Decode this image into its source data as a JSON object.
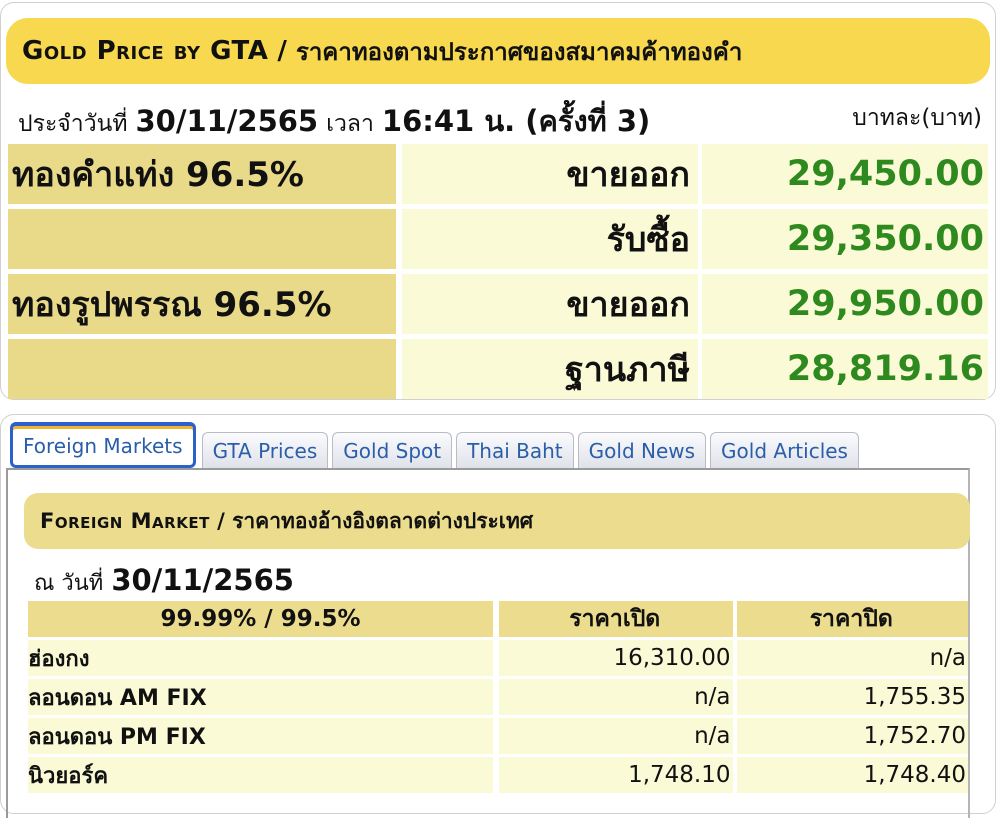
{
  "gta_panel": {
    "title_en": "Gold Price by GTA",
    "title_sep": " / ",
    "title_th": "ราคาทองตามประกาศของสมาคมค้าทองคำ",
    "date_label": "ประจำวันที่",
    "date": "30/11/2565",
    "time_label": "เวลา",
    "time": "16:41 น. (ครั้งที่ 3)",
    "unit": "บาทละ(บาท)",
    "rows": [
      {
        "name": "ทองคำแท่ง 96.5%",
        "type": "ขายออก",
        "value": "29,450.00"
      },
      {
        "name": "",
        "type": "รับซื้อ",
        "value": "29,350.00"
      },
      {
        "name": "ทองรูปพรรณ 96.5%",
        "type": "ขายออก",
        "value": "29,950.00"
      },
      {
        "name": "",
        "type": "ฐานภาษี",
        "value": "28,819.16"
      }
    ],
    "value_color": "#2e8a1e"
  },
  "tabs": [
    {
      "label": "Foreign Markets",
      "active": true
    },
    {
      "label": "GTA Prices",
      "active": false
    },
    {
      "label": "Gold Spot",
      "active": false
    },
    {
      "label": "Thai Baht",
      "active": false
    },
    {
      "label": "Gold News",
      "active": false
    },
    {
      "label": "Gold Articles",
      "active": false
    }
  ],
  "foreign_market": {
    "title_en": "Foreign Market",
    "title_sep": " / ",
    "title_th": "ราคาทองอ้างอิงตลาดต่างประเทศ",
    "date_label": "ณ วันที่",
    "date": "30/11/2565",
    "columns": [
      "99.99% / 99.5%",
      "ราคาเปิด",
      "ราคาปิด"
    ],
    "rows": [
      {
        "market": "ฮ่องกง",
        "open": "16,310.00",
        "close": "n/a"
      },
      {
        "market": "ลอนดอน AM FIX",
        "open": "n/a",
        "close": "1,755.35"
      },
      {
        "market": "ลอนดอน PM FIX",
        "open": "n/a",
        "close": "1,752.70"
      },
      {
        "market": "นิวยอร์ค",
        "open": "1,748.10",
        "close": "1,748.40"
      }
    ]
  }
}
